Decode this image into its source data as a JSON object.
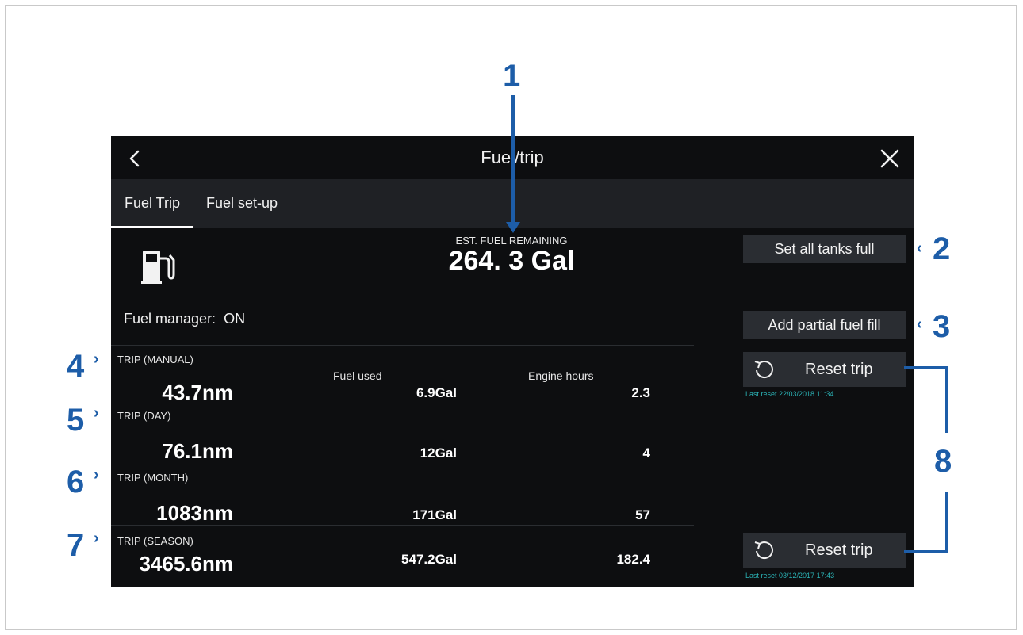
{
  "header": {
    "title": "Fuel/trip"
  },
  "tabs": [
    {
      "label": "Fuel Trip",
      "active": true
    },
    {
      "label": "Fuel set-up",
      "active": false
    }
  ],
  "fuel": {
    "est_label": "EST. FUEL REMAINING",
    "est_value": "264. 3 Gal",
    "manager_label": "Fuel manager:",
    "manager_status": "ON"
  },
  "buttons": {
    "set_all_full": "Set all tanks full",
    "add_partial": "Add partial fuel fill",
    "reset_trip": "Reset trip"
  },
  "last_reset": [
    "Last reset 22/03/2018 11:34",
    "Last reset 03/12/2017 17:43"
  ],
  "columns": {
    "fuel_used": "Fuel used",
    "engine_hours": "Engine hours"
  },
  "trips": [
    {
      "label": "TRIP (MANUAL)",
      "distance": "43.7nm",
      "fuel": "6.9Gal",
      "hours": "2.3"
    },
    {
      "label": "TRIP (DAY)",
      "distance": "76.1nm",
      "fuel": "12Gal",
      "hours": "4"
    },
    {
      "label": "TRIP (MONTH)",
      "distance": "1083nm",
      "fuel": "171Gal",
      "hours": "57"
    },
    {
      "label": "TRIP (SEASON)",
      "distance": "3465.6nm",
      "fuel": "547.2Gal",
      "hours": "182.4"
    }
  ],
  "callouts": [
    "1",
    "2",
    "3",
    "4",
    "5",
    "6",
    "7",
    "8"
  ],
  "colors": {
    "callout": "#1d5da8",
    "accent_teal": "#2bb3b6",
    "screen_bg": "#0d0e10",
    "tabbar_bg": "#1f2125",
    "button_bg": "#2a2d32"
  },
  "icons": {
    "back": "chevron-left-icon",
    "close": "close-icon",
    "pump": "fuel-pump-icon",
    "reset": "reset-icon"
  }
}
